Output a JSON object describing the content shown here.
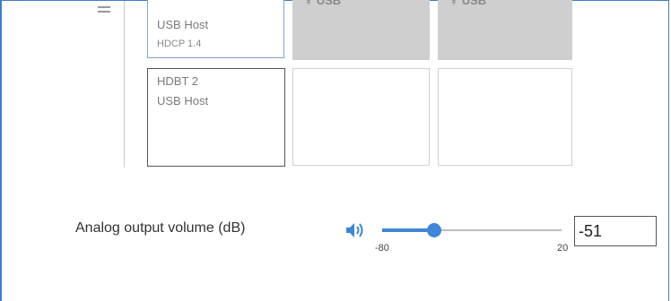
{
  "matrix": {
    "row1": {
      "selected_cell": {
        "line1": "USB Host",
        "line2": "HDCP 1.4"
      },
      "usb_cells": [
        {
          "label": "USB",
          "icon": "usb-icon"
        },
        {
          "label": "USB",
          "icon": "usb-icon"
        }
      ]
    },
    "row2": {
      "input_cell": {
        "line1": "HDBT 2",
        "line2": "USB Host"
      }
    }
  },
  "volume": {
    "label": "Analog output volume (dB)",
    "min_label": "-80",
    "max_label": "20",
    "value": "-51",
    "min": -80,
    "max": 20,
    "fill_fraction": 0.29,
    "icon": "speaker-icon"
  },
  "colors": {
    "accent": "#3f86d6",
    "frame_border": "#3f7fc4",
    "disabled_cell": "#cfcfcf"
  }
}
